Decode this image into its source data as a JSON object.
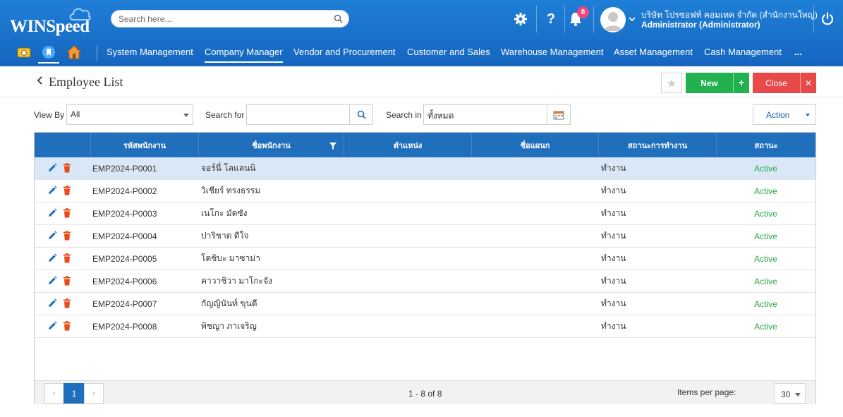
{
  "app": {
    "logo_text": "WINSpeed",
    "search_placeholder": "Search here...",
    "notification_count": "8",
    "company": "บริษัท โปรซอฟท์ คอมเทค จำกัด (สำนักงานใหญ่)",
    "user": "Administrator (Administrator)"
  },
  "menu": {
    "items": [
      {
        "label": "System Management"
      },
      {
        "label": "Company Manager"
      },
      {
        "label": "Vendor and Procurement"
      },
      {
        "label": "Customer and Sales"
      },
      {
        "label": "Warehouse Management"
      },
      {
        "label": "Asset Management"
      },
      {
        "label": "Cash Management"
      },
      {
        "label": "..."
      }
    ],
    "active": "Company Manager"
  },
  "page": {
    "title": "Employee List",
    "new_label": "New",
    "close_label": "Close"
  },
  "filters": {
    "view_by_label": "View By",
    "view_by_value": "All",
    "search_for_label": "Search for",
    "search_for_value": "",
    "search_in_label": "Search in",
    "search_in_value": "ทั้งหมด",
    "action_label": "Action"
  },
  "table": {
    "columns": [
      "รหัสพนักงาน",
      "ชื่อพนักงาน",
      "ตำแหน่ง",
      "ชื่อแผนก",
      "สถานะการทำงาน",
      "สถานะ"
    ],
    "rows": [
      {
        "code": "EMP2024-P0001",
        "name": "จอร์นี่ โลแลนนิ",
        "position": "",
        "dept": "",
        "work": "ทำงาน",
        "status": "Active"
      },
      {
        "code": "EMP2024-P0002",
        "name": "วิเชียร์ ทรงธรรม",
        "position": "",
        "dept": "",
        "work": "ทำงาน",
        "status": "Active"
      },
      {
        "code": "EMP2024-P0003",
        "name": "เนโกะ มัดซัง",
        "position": "",
        "dept": "",
        "work": "ทำงาน",
        "status": "Active"
      },
      {
        "code": "EMP2024-P0004",
        "name": "ปาริชาต ดีใจ",
        "position": "",
        "dept": "",
        "work": "ทำงาน",
        "status": "Active"
      },
      {
        "code": "EMP2024-P0005",
        "name": "โตชิบะ มาซาม่า",
        "position": "",
        "dept": "",
        "work": "ทำงาน",
        "status": "Active"
      },
      {
        "code": "EMP2024-P0006",
        "name": "คาวาชิวา มาโกะจัง",
        "position": "",
        "dept": "",
        "work": "ทำงาน",
        "status": "Active"
      },
      {
        "code": "EMP2024-P0007",
        "name": "กัญญินันท์ ขุนดี",
        "position": "",
        "dept": "",
        "work": "ทำงาน",
        "status": "Active"
      },
      {
        "code": "EMP2024-P0008",
        "name": "พิชญา ภาเจริญ",
        "position": "",
        "dept": "",
        "work": "ทำงาน",
        "status": "Active"
      }
    ]
  },
  "pagination": {
    "prev": "‹",
    "current": "1",
    "next": "›",
    "range": "1 - 8 of 8",
    "ipp_label": "Items per page:",
    "ipp_value": "30"
  },
  "colors": {
    "header_bg": "#1565c0",
    "table_head": "#1f6fbd",
    "new_btn": "#21b14f",
    "close_btn": "#e84a4a",
    "status_active": "#27a846",
    "selected_row": "#d9e7f7"
  }
}
